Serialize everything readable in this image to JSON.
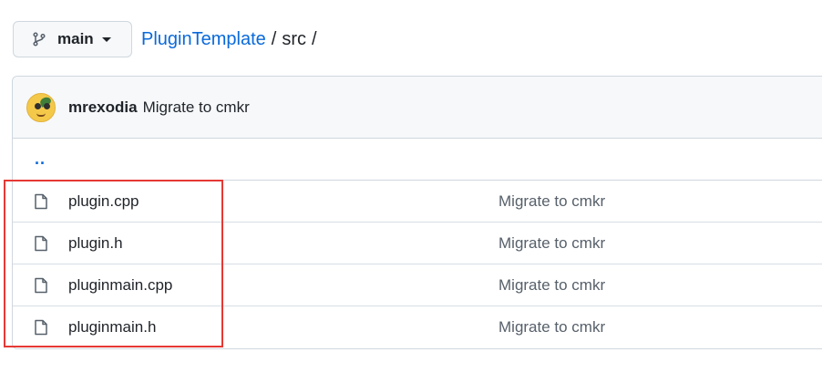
{
  "branch": {
    "name": "main",
    "icon": "git-branch-icon"
  },
  "breadcrumb": {
    "repo": "PluginTemplate",
    "separator": "/",
    "dir": "src",
    "trailing": "/"
  },
  "latest_commit": {
    "author": "mrexodia",
    "message": "Migrate to cmkr"
  },
  "parent_link": "..",
  "files": [
    {
      "name": "plugin.cpp",
      "commit_message": "Migrate to cmkr"
    },
    {
      "name": "plugin.h",
      "commit_message": "Migrate to cmkr"
    },
    {
      "name": "pluginmain.cpp",
      "commit_message": "Migrate to cmkr"
    },
    {
      "name": "pluginmain.h",
      "commit_message": "Migrate to cmkr"
    }
  ],
  "colors": {
    "link": "#0969da",
    "highlight": "#e53935",
    "border": "#d0d7de"
  }
}
